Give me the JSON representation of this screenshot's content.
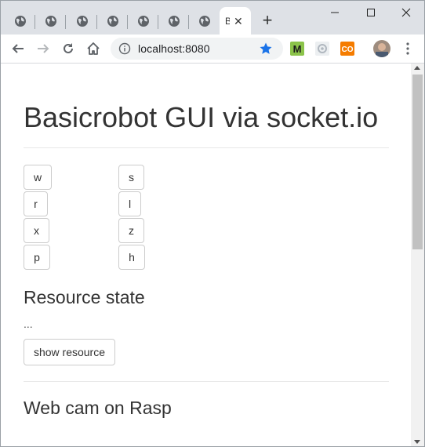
{
  "browser": {
    "active_tab_title": "B",
    "address": "localhost:8080",
    "new_tab_label": "+",
    "minimize_label": "—",
    "close_label": "✕",
    "tab_close_label": "✕",
    "extensions": [
      {
        "name": "M",
        "color": "#7cb342"
      },
      {
        "name": "gear",
        "color": "#b0b7bf"
      },
      {
        "name": "CO",
        "color": "#ef6c00"
      }
    ],
    "star_color": "#1a73e8"
  },
  "page": {
    "title": "Basicrobot GUI via socket.io",
    "commands": {
      "left": [
        "w",
        "r",
        "x",
        "p"
      ],
      "right": [
        "s",
        "l",
        "z",
        "h"
      ]
    },
    "resource_heading": "Resource state",
    "resource_value": "...",
    "show_resource_label": "show resource",
    "webcam_heading": "Web cam on Rasp"
  }
}
